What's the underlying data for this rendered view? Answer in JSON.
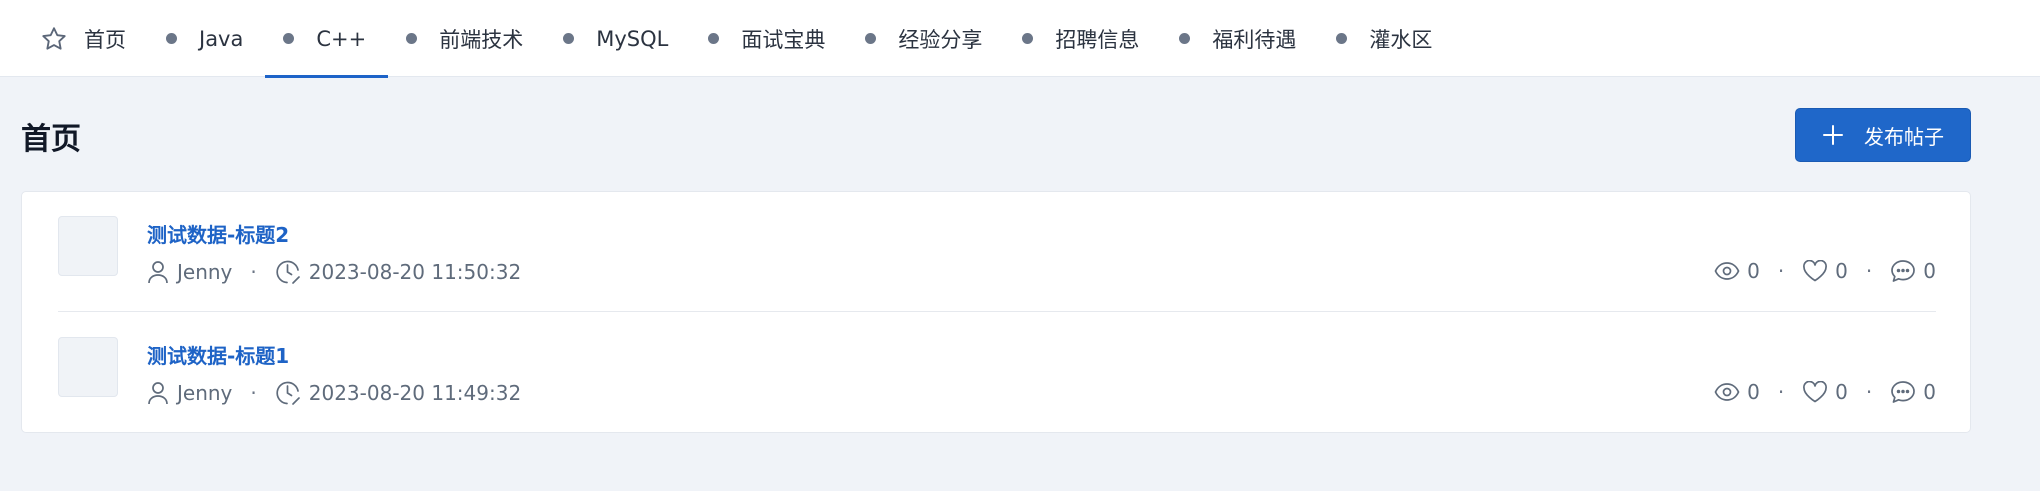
{
  "nav": {
    "tabs": [
      {
        "label": "首页",
        "icon": "star-icon"
      },
      {
        "label": "Java",
        "icon": "dot"
      },
      {
        "label": "C++",
        "icon": "dot",
        "active": true
      },
      {
        "label": "前端技术",
        "icon": "dot"
      },
      {
        "label": "MySQL",
        "icon": "dot"
      },
      {
        "label": "面试宝典",
        "icon": "dot"
      },
      {
        "label": "经验分享",
        "icon": "dot"
      },
      {
        "label": "招聘信息",
        "icon": "dot"
      },
      {
        "label": "福利待遇",
        "icon": "dot"
      },
      {
        "label": "灌水区",
        "icon": "dot"
      }
    ]
  },
  "page": {
    "title": "首页",
    "publish_label": "发布帖子"
  },
  "posts": [
    {
      "title": "测试数据-标题2",
      "author": "Jenny",
      "time": "2023-08-20 11:50:32",
      "views": "0",
      "likes": "0",
      "comments": "0"
    },
    {
      "title": "测试数据-标题1",
      "author": "Jenny",
      "time": "2023-08-20 11:49:32",
      "views": "0",
      "likes": "0",
      "comments": "0"
    }
  ],
  "separator": "·",
  "colors": {
    "accent": "#1f67c9",
    "link": "#1e63c6",
    "background": "#f0f3f8"
  }
}
